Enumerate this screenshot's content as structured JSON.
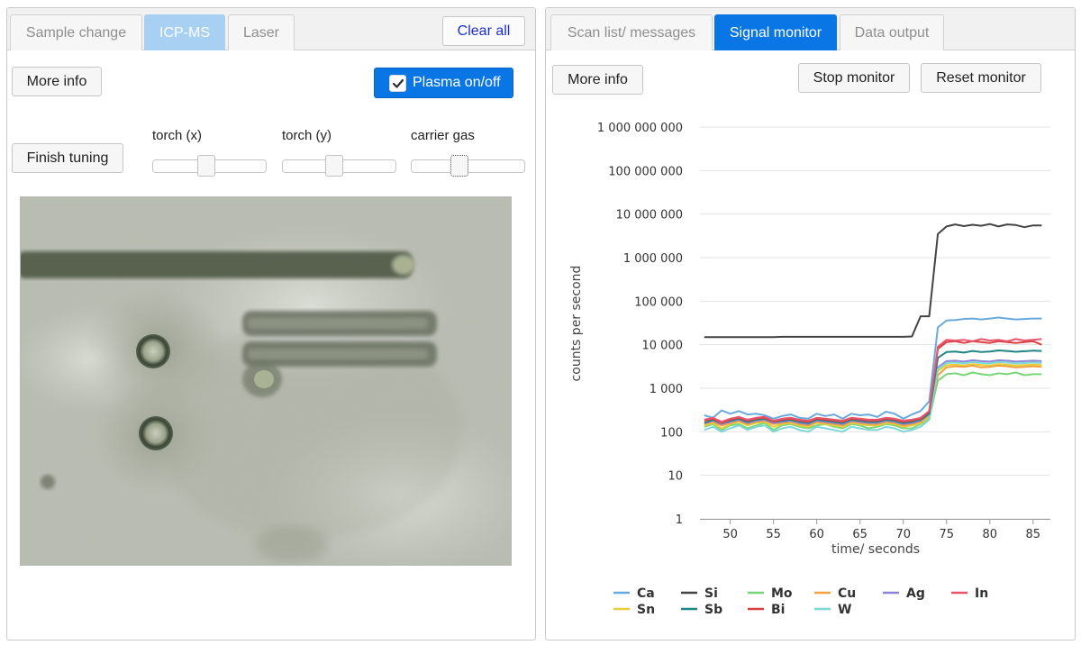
{
  "left_panel": {
    "tabs": [
      {
        "label": "Sample change",
        "state": "inactive"
      },
      {
        "label": "ICP-MS",
        "state": "active"
      },
      {
        "label": "Laser",
        "state": "inactive"
      }
    ],
    "clear_all_label": "Clear all",
    "more_info_label": "More info",
    "plasma_toggle": {
      "label": "Plasma on/off",
      "checked": true
    },
    "finish_tuning_label": "Finish tuning",
    "sliders": [
      {
        "label": "torch (x)",
        "position": 0.46
      },
      {
        "label": "torch (y)",
        "position": 0.44
      },
      {
        "label": "carrier gas",
        "position": 0.4
      }
    ]
  },
  "right_panel": {
    "tabs": [
      {
        "label": "Scan list/ messages",
        "state": "inactive"
      },
      {
        "label": "Signal monitor",
        "state": "active"
      },
      {
        "label": "Data output",
        "state": "inactive"
      }
    ],
    "more_info_label": "More info",
    "stop_monitor_label": "Stop monitor",
    "reset_monitor_label": "Reset monitor"
  },
  "colors": {
    "accent": "#0a76e6",
    "accent_light": "#a8d0f3"
  },
  "chart_data": {
    "type": "line",
    "xlabel": "time/ seconds",
    "ylabel": "counts per second",
    "y_scale": "log",
    "xlim": [
      46.5,
      87
    ],
    "ylim": [
      1,
      1000000000
    ],
    "x_ticks": [
      50,
      55,
      60,
      65,
      70,
      75,
      80,
      85
    ],
    "y_ticks": [
      {
        "value": 1,
        "label": "1"
      },
      {
        "value": 10,
        "label": "10"
      },
      {
        "value": 100,
        "label": "100"
      },
      {
        "value": 1000,
        "label": "1 000"
      },
      {
        "value": 10000,
        "label": "10 000"
      },
      {
        "value": 100000,
        "label": "100 000"
      },
      {
        "value": 1000000,
        "label": "1 000 000"
      },
      {
        "value": 10000000,
        "label": "10 000 000"
      },
      {
        "value": 100000000,
        "label": "100 000 000"
      },
      {
        "value": 1000000000,
        "label": "1 000 000 000"
      }
    ],
    "grid": true,
    "legend_position": "bottom",
    "x": [
      47,
      48,
      49,
      50,
      51,
      52,
      53,
      54,
      55,
      56,
      57,
      58,
      59,
      60,
      61,
      62,
      63,
      64,
      65,
      66,
      67,
      68,
      69,
      70,
      71,
      72,
      73,
      74,
      75,
      76,
      77,
      78,
      79,
      80,
      81,
      82,
      83,
      84,
      85,
      86
    ],
    "series": [
      {
        "name": "Ca",
        "color": "#6aa9dc",
        "values": [
          240,
          210,
          310,
          260,
          300,
          250,
          260,
          240,
          200,
          230,
          250,
          210,
          200,
          260,
          230,
          250,
          200,
          260,
          240,
          250,
          220,
          290,
          260,
          200,
          250,
          300,
          500,
          25000,
          36000,
          37000,
          39000,
          40000,
          38000,
          40000,
          42000,
          40000,
          38000,
          39000,
          40000,
          40000
        ]
      },
      {
        "name": "Si",
        "color": "#444444",
        "values": [
          15000,
          15000,
          15000,
          15000,
          15000,
          15000,
          15000,
          15000,
          15000,
          15200,
          15200,
          15200,
          15200,
          15200,
          15200,
          15200,
          15200,
          15200,
          15200,
          15200,
          15200,
          15200,
          15200,
          15200,
          15500,
          45000,
          45000,
          3500000,
          5200000,
          5800000,
          5300000,
          5700000,
          5400000,
          5900000,
          5200000,
          5800000,
          5600000,
          5000000,
          5500000,
          5500000
        ]
      },
      {
        "name": "Mo",
        "color": "#7ad67a",
        "values": [
          130,
          150,
          110,
          140,
          150,
          120,
          140,
          160,
          110,
          140,
          150,
          130,
          120,
          140,
          150,
          130,
          120,
          150,
          140,
          120,
          130,
          150,
          140,
          120,
          120,
          150,
          200,
          1500,
          2100,
          2200,
          2000,
          2300,
          2100,
          2000,
          2200,
          2100,
          2300,
          2000,
          2100,
          2100
        ]
      },
      {
        "name": "Cu",
        "color": "#f0a142",
        "values": [
          150,
          170,
          140,
          160,
          180,
          150,
          170,
          180,
          150,
          160,
          170,
          150,
          140,
          170,
          160,
          150,
          140,
          170,
          160,
          150,
          150,
          170,
          160,
          140,
          150,
          170,
          240,
          2000,
          3000,
          3200,
          3100,
          3300,
          3000,
          3100,
          3300,
          3200,
          3000,
          3100,
          3200,
          3100
        ]
      },
      {
        "name": "Ag",
        "color": "#8b84d8",
        "values": [
          160,
          180,
          150,
          170,
          190,
          160,
          180,
          190,
          160,
          170,
          180,
          160,
          150,
          180,
          170,
          160,
          150,
          180,
          170,
          160,
          160,
          180,
          170,
          150,
          160,
          180,
          260,
          3000,
          4200,
          4300,
          4100,
          4400,
          4200,
          4100,
          4400,
          4300,
          4100,
          4200,
          4300,
          4200
        ]
      },
      {
        "name": "In",
        "color": "#e8546c",
        "values": [
          190,
          210,
          170,
          200,
          220,
          190,
          210,
          220,
          180,
          200,
          210,
          190,
          180,
          210,
          200,
          190,
          180,
          210,
          200,
          190,
          190,
          210,
          200,
          180,
          190,
          210,
          300,
          9000,
          13000,
          12500,
          13000,
          12000,
          13500,
          12500,
          13000,
          12000,
          13500,
          12500,
          13000,
          13500
        ]
      },
      {
        "name": "Sn",
        "color": "#e8cf3a",
        "values": [
          140,
          160,
          120,
          150,
          170,
          140,
          160,
          170,
          130,
          150,
          160,
          140,
          130,
          160,
          150,
          140,
          130,
          160,
          150,
          140,
          140,
          160,
          150,
          130,
          140,
          160,
          220,
          2500,
          3400,
          3500,
          3300,
          3600,
          3400,
          3300,
          3600,
          3500,
          3300,
          3400,
          3500,
          3400
        ]
      },
      {
        "name": "Sb",
        "color": "#1f8585",
        "values": [
          160,
          190,
          160,
          180,
          200,
          170,
          190,
          200,
          170,
          180,
          190,
          170,
          160,
          190,
          180,
          170,
          160,
          190,
          180,
          170,
          170,
          190,
          180,
          160,
          170,
          190,
          260,
          5000,
          6800,
          7000,
          6600,
          7200,
          6800,
          7000,
          7400,
          7200,
          6900,
          7100,
          7300,
          7200
        ]
      },
      {
        "name": "Bi",
        "color": "#d94141",
        "values": [
          180,
          200,
          160,
          190,
          210,
          180,
          200,
          210,
          170,
          190,
          200,
          180,
          170,
          200,
          190,
          180,
          170,
          200,
          190,
          180,
          180,
          200,
          190,
          170,
          180,
          200,
          290,
          8000,
          11500,
          12000,
          11000,
          12000,
          11500,
          11000,
          12000,
          11500,
          11000,
          11500,
          12000,
          10000
        ]
      },
      {
        "name": "W",
        "color": "#7fd6d6",
        "values": [
          110,
          130,
          100,
          120,
          140,
          110,
          130,
          140,
          100,
          120,
          130,
          110,
          100,
          130,
          120,
          110,
          100,
          130,
          120,
          110,
          110,
          130,
          120,
          100,
          110,
          130,
          190,
          2800,
          3800,
          3900,
          3700,
          4000,
          3800,
          3700,
          4000,
          3900,
          3700,
          3800,
          3900,
          3800
        ]
      }
    ]
  }
}
